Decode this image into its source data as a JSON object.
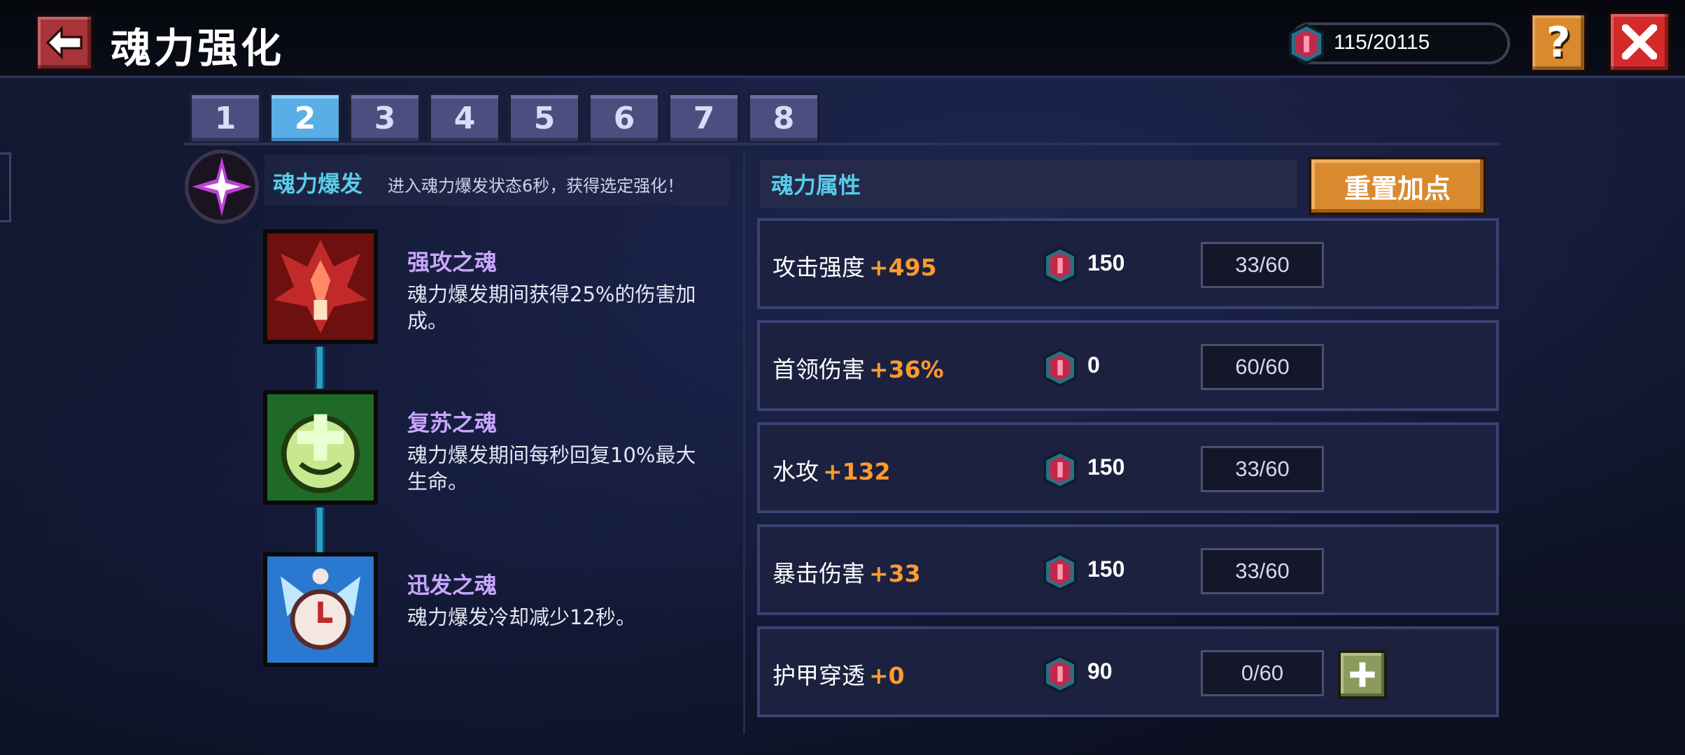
{
  "header": {
    "title": "魂力强化",
    "currency": "115/20115"
  },
  "tabs": [
    "1",
    "2",
    "3",
    "4",
    "5",
    "6",
    "7",
    "8"
  ],
  "active_tab": "2",
  "burst": {
    "title": "魂力爆发",
    "desc": "进入魂力爆发状态6秒，获得选定强化！"
  },
  "skills": [
    {
      "name": "强攻之魂",
      "desc": "魂力爆发期间获得25%的伤害加成。",
      "icon": "red-flame-spirit-icon"
    },
    {
      "name": "复苏之魂",
      "desc": "魂力爆发期间每秒回复10%最大生命。",
      "icon": "green-heal-spirit-icon"
    },
    {
      "name": "迅发之魂",
      "desc": "魂力爆发冷却减少12秒。",
      "icon": "blue-clock-spirit-icon"
    }
  ],
  "attributes": {
    "title": "魂力属性",
    "reset_label": "重置加点",
    "rows": [
      {
        "name": "攻击强度",
        "value": "+495",
        "cost": "150",
        "level": "33/60"
      },
      {
        "name": "首领伤害",
        "value": "+36%",
        "cost": "0",
        "level": "60/60"
      },
      {
        "name": "水攻",
        "value": "+132",
        "cost": "150",
        "level": "33/60"
      },
      {
        "name": "暴击伤害",
        "value": "+33",
        "cost": "150",
        "level": "33/60"
      },
      {
        "name": "护甲穿透",
        "value": "+0",
        "cost": "90",
        "level": "0/60"
      }
    ]
  },
  "colors": {
    "accent_cyan": "#58cce8",
    "value_orange": "#ff9a2e",
    "skill_purple": "#c8a6ff",
    "tab_active": "#5aaee6",
    "tab_inactive": "#4b4f80",
    "close_red": "#d42a2a",
    "help_orange": "#d98a2e"
  },
  "icons": [
    "back-arrow-icon",
    "soul-gem-icon",
    "question-mark-icon",
    "close-x-icon",
    "soul-burst-star-icon",
    "plus-icon"
  ]
}
